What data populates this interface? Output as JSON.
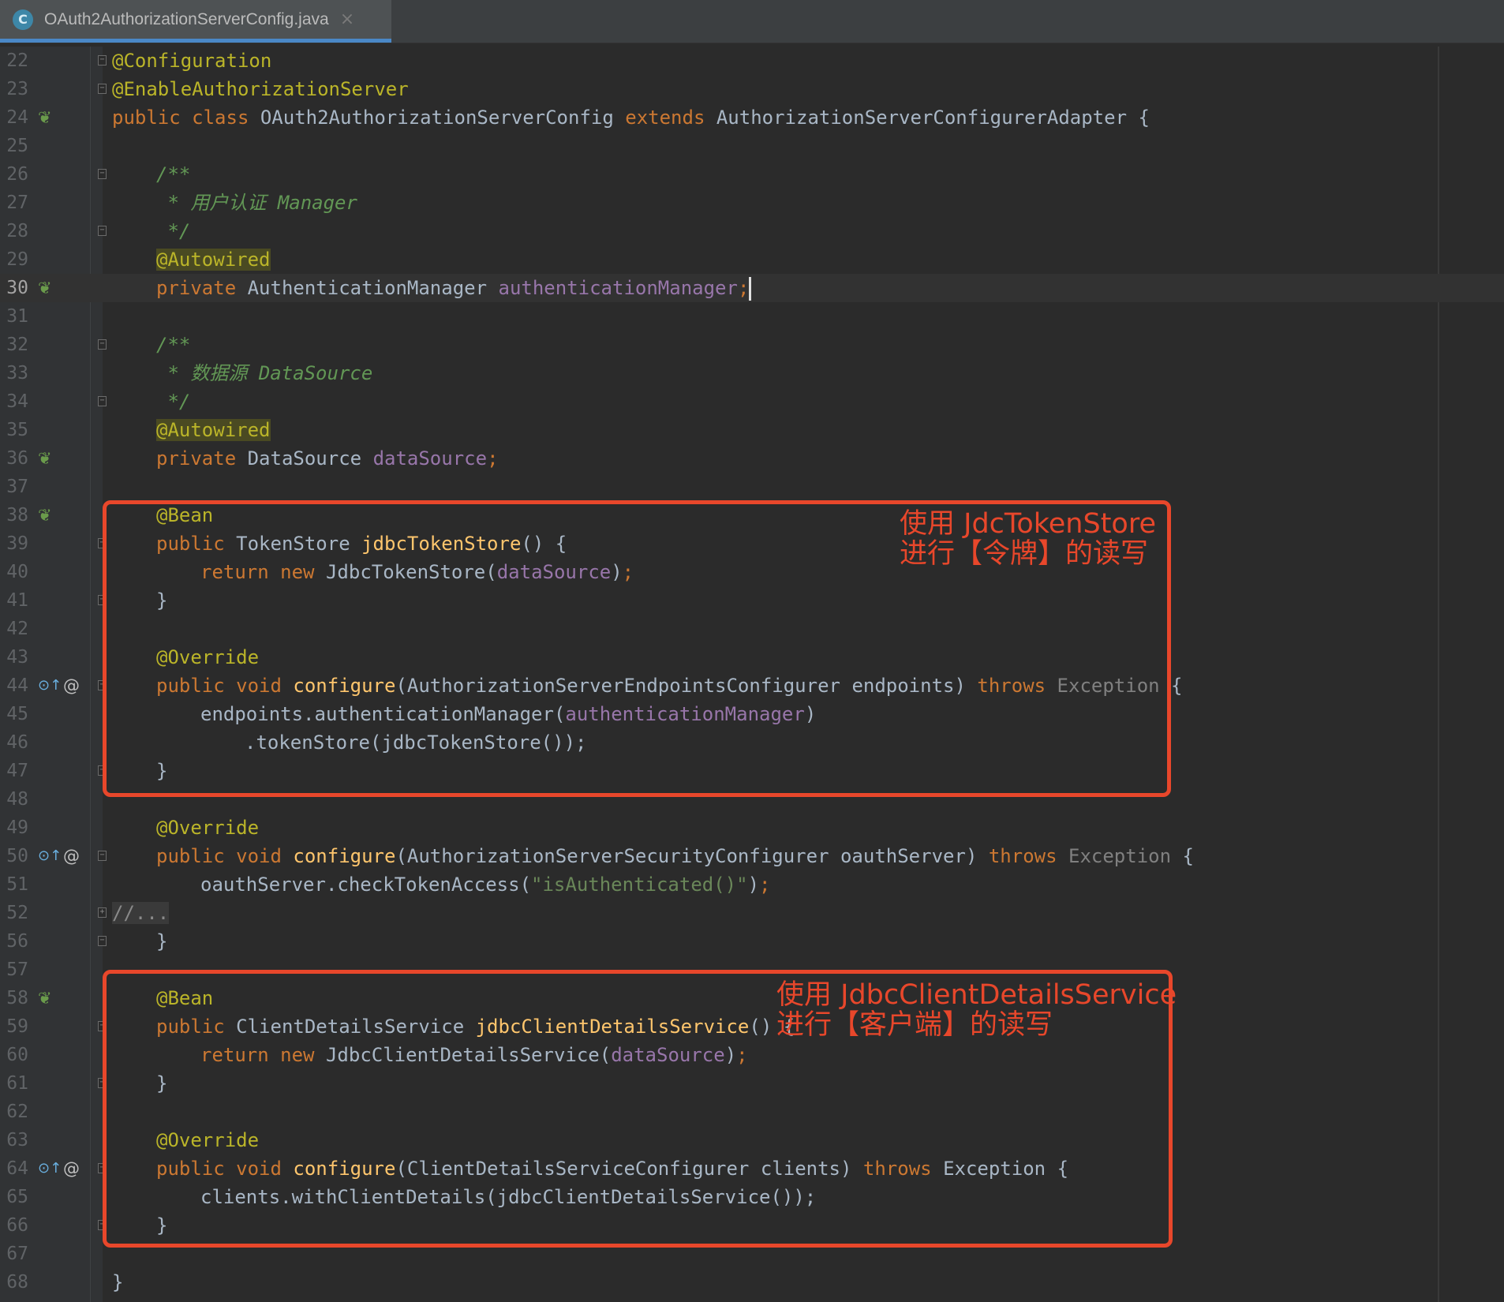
{
  "tab": {
    "icon_letter": "C",
    "title": "OAuth2AuthorizationServerConfig.java",
    "close": "×"
  },
  "lines": [
    {
      "n": "22"
    },
    {
      "n": "23"
    },
    {
      "n": "24"
    },
    {
      "n": "25"
    },
    {
      "n": "26"
    },
    {
      "n": "27"
    },
    {
      "n": "28"
    },
    {
      "n": "29"
    },
    {
      "n": "30"
    },
    {
      "n": "31"
    },
    {
      "n": "32"
    },
    {
      "n": "33"
    },
    {
      "n": "34"
    },
    {
      "n": "35"
    },
    {
      "n": "36"
    },
    {
      "n": "37"
    },
    {
      "n": "38"
    },
    {
      "n": "39"
    },
    {
      "n": "40"
    },
    {
      "n": "41"
    },
    {
      "n": "42"
    },
    {
      "n": "43"
    },
    {
      "n": "44"
    },
    {
      "n": "45"
    },
    {
      "n": "46"
    },
    {
      "n": "47"
    },
    {
      "n": "48"
    },
    {
      "n": "49"
    },
    {
      "n": "50"
    },
    {
      "n": "51"
    },
    {
      "n": "52"
    },
    {
      "n": "56"
    },
    {
      "n": "57"
    },
    {
      "n": "58"
    },
    {
      "n": "59"
    },
    {
      "n": "60"
    },
    {
      "n": "61"
    },
    {
      "n": "62"
    },
    {
      "n": "63"
    },
    {
      "n": "64"
    },
    {
      "n": "65"
    },
    {
      "n": "66"
    },
    {
      "n": "67"
    },
    {
      "n": "68"
    }
  ],
  "code": {
    "ann_configuration": "@Configuration",
    "ann_enable": "@EnableAuthorizationServer",
    "kw_public": "public",
    "kw_class": "class",
    "kw_extends": "extends",
    "kw_private": "private",
    "kw_return": "return",
    "kw_new": "new",
    "kw_void": "void",
    "kw_throws": "throws",
    "class_name": "OAuth2AuthorizationServerConfig",
    "super_class": "AuthorizationServerConfigurerAdapter",
    "open_brace": "{",
    "close_brace": "}",
    "doc_open": "/**",
    "doc_close": "*/",
    "doc_star": "*",
    "doc_user_cn": "用户认证",
    "doc_user_en": "Manager",
    "doc_ds_cn": "数据源",
    "doc_ds_en": "DataSource",
    "ann_autowired": "@Autowired",
    "ann_bean": "@Bean",
    "ann_override": "@Override",
    "type_auth_manager": "AuthenticationManager",
    "field_auth_manager": "authenticationManager",
    "type_datasource": "DataSource",
    "field_datasource": "dataSource",
    "semicolon": ";",
    "type_tokenstore": "TokenStore",
    "m_jdbc_token_store": "jdbcTokenStore",
    "parens": "()",
    "jdbc_token_store_cls": "JdbcTokenStore",
    "lparen": "(",
    "rparen": ")",
    "m_configure": "configure",
    "type_endpoints_cfg": "AuthorizationServerEndpointsConfigurer",
    "p_endpoints": "endpoints",
    "type_exception": "Exception",
    "endpoints_call": "endpoints.authenticationManager",
    "token_store_call": ".tokenStore(jdbcTokenStore());",
    "type_security_cfg": "AuthorizationServerSecurityConfigurer",
    "p_oauth_server": "oauthServer",
    "check_token_call": "oauthServer.checkTokenAccess",
    "str_is_auth": "\"isAuthenticated()\"",
    "folded_comment": "//...",
    "type_client_details_service": "ClientDetailsService",
    "m_jdbc_client_details_service": "jdbcClientDetailsService",
    "jdbc_client_details_cls": "JdbcClientDetailsService",
    "type_client_cfg": "ClientDetailsServiceConfigurer",
    "p_clients": "clients",
    "with_client_details_call": "clients.withClientDetails(jdbcClientDetailsService());"
  },
  "annotations": {
    "box1_line1": "使用 JdcTokenStore",
    "box1_line2": "进行【令牌】的读写",
    "box2_line1": "使用 JdbcClientDetailsService",
    "box2_line2": "进行【客户端】的读写",
    "color": "#e8472b"
  },
  "gutter_icons": {
    "bean": "bean-icon",
    "override": "override-icon",
    "at": "@"
  },
  "colors": {
    "background": "#2b2b2b",
    "keyword": "#cc7832",
    "annotation": "#bbb529",
    "comment": "#629755",
    "field": "#9876aa",
    "method": "#ffc66d",
    "string": "#6a8759",
    "text": "#a9b7c6"
  }
}
